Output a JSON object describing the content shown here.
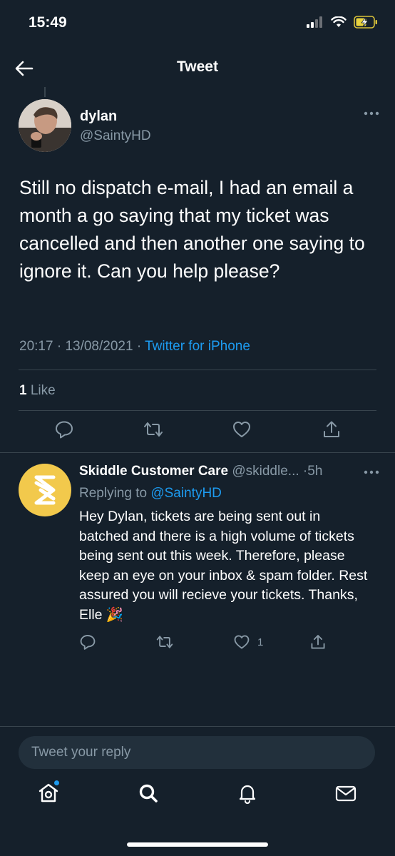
{
  "status_bar": {
    "time": "15:49"
  },
  "header": {
    "title": "Tweet"
  },
  "tweet": {
    "name": "dylan",
    "handle": "@SaintyHD",
    "text": "Still no dispatch e-mail, I had an email a month a go saying that my ticket was cancelled and then another one saying to ignore it. Can you help please?",
    "time": "20:17",
    "date": "13/08/2021",
    "source": "Twitter for iPhone",
    "like_count": "1",
    "like_label": "Like"
  },
  "reply": {
    "name": "Skiddle Customer Care",
    "handle": "@skiddle...",
    "age": "5h",
    "replying_label": "Replying to",
    "replying_handle": "@SaintyHD",
    "text": "Hey Dylan, tickets are being sent out in batched and there is a high volume of tickets being sent out this week. Therefore, please keep an eye on your inbox & spam folder. Rest assured you will recieve your tickets. Thanks, Elle 🎉",
    "like_count": "1"
  },
  "composer": {
    "placeholder": "Tweet your reply"
  },
  "colors": {
    "background": "#15202b",
    "accent": "#1d9bf0",
    "muted": "#8899a6",
    "divider": "#38444d"
  },
  "icons": [
    "back-arrow-icon",
    "more-icon",
    "reply-icon",
    "retweet-icon",
    "like-icon",
    "share-icon",
    "home-icon",
    "search-icon",
    "notifications-icon",
    "messages-icon"
  ]
}
